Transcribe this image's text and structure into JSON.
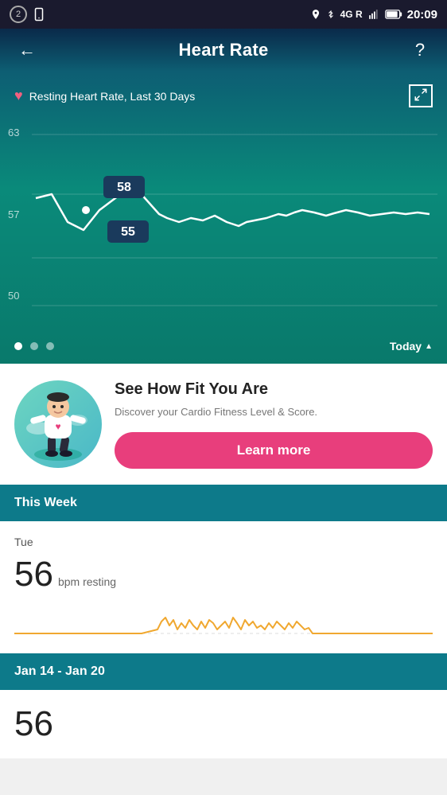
{
  "statusBar": {
    "leftIcons": [
      "circle-number",
      "phone-icon"
    ],
    "circleLabel": "2",
    "rightIcons": [
      "location-icon",
      "bluetooth-icon",
      "signal-icon",
      "battery-icon"
    ],
    "time": "20:09",
    "network": "4G R"
  },
  "header": {
    "backLabel": "←",
    "title": "Heart Rate",
    "helpLabel": "?"
  },
  "chart": {
    "subtitle": "Resting Heart Rate, Last 30 Days",
    "yLabels": [
      "63",
      "57",
      "50"
    ],
    "tooltipHigh": "58",
    "tooltipLow": "55",
    "todayLabel": "Today",
    "dots": [
      {
        "active": true
      },
      {
        "active": false
      },
      {
        "active": false
      }
    ]
  },
  "fitnessCard": {
    "title": "See How Fit You Are",
    "description": "Discover your Cardio Fitness Level & Score.",
    "buttonLabel": "Learn more"
  },
  "thisWeek": {
    "sectionLabel": "This Week",
    "dayLabel": "Tue",
    "bpmValue": "56",
    "bpmUnit": "bpm resting"
  },
  "dateRange": {
    "label": "Jan 14 - Jan 20",
    "bpmValue": "56"
  }
}
